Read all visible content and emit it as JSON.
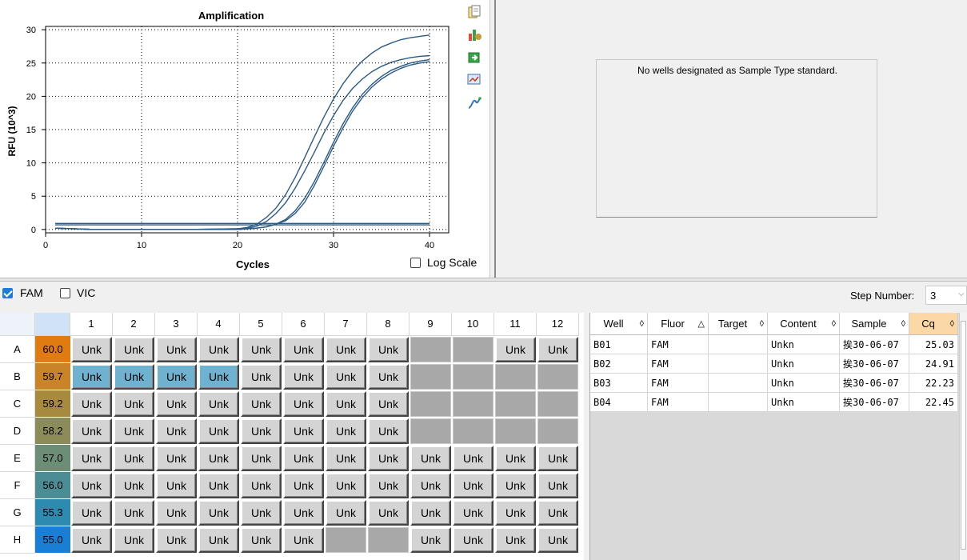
{
  "chart": {
    "title": "Amplification",
    "xlabel": "Cycles",
    "ylabel": "RFU (10^3)",
    "log_scale_label": "Log Scale",
    "log_scale_checked": false
  },
  "chart_data": {
    "type": "line",
    "title": "Amplification",
    "xlabel": "Cycles",
    "ylabel": "RFU (10^3)",
    "xlim": [
      0,
      42
    ],
    "ylim": [
      -0.5,
      30.5
    ],
    "xticks": [
      0,
      10,
      20,
      30,
      40
    ],
    "yticks": [
      0,
      5,
      10,
      15,
      20,
      25,
      30
    ],
    "grid": true,
    "series": [
      {
        "x": [
          1,
          5,
          10,
          15,
          20,
          21,
          22,
          23,
          24,
          25,
          26,
          27,
          28,
          29,
          30,
          31,
          32,
          33,
          34,
          35,
          36,
          37,
          38,
          39,
          40
        ],
        "y": [
          0.2,
          0.0,
          0.0,
          0.0,
          0.1,
          0.3,
          0.8,
          1.8,
          3.2,
          5.2,
          7.8,
          10.8,
          13.9,
          16.9,
          19.6,
          21.9,
          23.8,
          25.3,
          26.5,
          27.4,
          28.0,
          28.5,
          28.8,
          29.0,
          29.2
        ]
      },
      {
        "x": [
          1,
          5,
          10,
          15,
          20,
          21,
          22,
          23,
          24,
          25,
          26,
          27,
          28,
          29,
          30,
          31,
          32,
          33,
          34,
          35,
          36,
          37,
          38,
          39,
          40
        ],
        "y": [
          0.2,
          0.0,
          0.0,
          0.0,
          0.1,
          0.2,
          0.5,
          1.2,
          2.4,
          4.0,
          6.2,
          8.8,
          11.6,
          14.5,
          17.1,
          19.4,
          21.2,
          22.6,
          23.7,
          24.5,
          25.1,
          25.5,
          25.8,
          26.0,
          26.1
        ]
      },
      {
        "x": [
          1,
          5,
          10,
          15,
          20,
          21,
          22,
          23,
          24,
          25,
          26,
          27,
          28,
          29,
          30,
          31,
          32,
          33,
          34,
          35,
          36,
          37,
          38,
          39,
          40
        ],
        "y": [
          0.2,
          0.0,
          0.0,
          0.0,
          0.0,
          0.1,
          0.2,
          0.4,
          0.8,
          1.5,
          2.8,
          4.7,
          7.2,
          10.1,
          13.1,
          15.9,
          18.3,
          20.3,
          21.8,
          23.0,
          23.9,
          24.5,
          25.0,
          25.3,
          25.5
        ]
      },
      {
        "x": [
          1,
          5,
          10,
          15,
          20,
          21,
          22,
          23,
          24,
          25,
          26,
          27,
          28,
          29,
          30,
          31,
          32,
          33,
          34,
          35,
          36,
          37,
          38,
          39,
          40
        ],
        "y": [
          0.2,
          0.0,
          0.0,
          0.0,
          0.0,
          0.1,
          0.2,
          0.4,
          0.8,
          1.3,
          2.4,
          4.1,
          6.6,
          9.5,
          12.5,
          15.3,
          17.8,
          19.8,
          21.4,
          22.6,
          23.5,
          24.2,
          24.7,
          25.0,
          25.2
        ]
      },
      {
        "x": [
          1,
          40
        ],
        "y": [
          0.9,
          0.9
        ]
      },
      {
        "x": [
          1,
          40
        ],
        "y": [
          0.7,
          0.7
        ]
      }
    ]
  },
  "standard_panel": {
    "message": "No wells designated as Sample Type standard."
  },
  "toolbar": {
    "fam_label": "FAM",
    "fam_checked": true,
    "vic_label": "VIC",
    "vic_checked": false,
    "step_label": "Step Number:",
    "step_value": "3"
  },
  "plate": {
    "columns": [
      "1",
      "2",
      "3",
      "4",
      "5",
      "6",
      "7",
      "8",
      "9",
      "10",
      "11",
      "12"
    ],
    "rows": [
      {
        "label": "A",
        "temp": "60.0",
        "color": "#e07b12",
        "wells": [
          "Unk",
          "Unk",
          "Unk",
          "Unk",
          "Unk",
          "Unk",
          "Unk",
          "Unk",
          "",
          "",
          "Unk",
          "Unk"
        ],
        "selected": []
      },
      {
        "label": "B",
        "temp": "59.7",
        "color": "#c98427",
        "wells": [
          "Unk",
          "Unk",
          "Unk",
          "Unk",
          "Unk",
          "Unk",
          "Unk",
          "Unk",
          "",
          "",
          "",
          ""
        ],
        "selected": [
          0,
          1,
          2,
          3
        ]
      },
      {
        "label": "C",
        "temp": "59.2",
        "color": "#a88a3e",
        "wells": [
          "Unk",
          "Unk",
          "Unk",
          "Unk",
          "Unk",
          "Unk",
          "Unk",
          "Unk",
          "",
          "",
          "",
          ""
        ],
        "selected": []
      },
      {
        "label": "D",
        "temp": "58.2",
        "color": "#8c8c5a",
        "wells": [
          "Unk",
          "Unk",
          "Unk",
          "Unk",
          "Unk",
          "Unk",
          "Unk",
          "Unk",
          "",
          "",
          "",
          ""
        ],
        "selected": []
      },
      {
        "label": "E",
        "temp": "57.0",
        "color": "#6d8e76",
        "wells": [
          "Unk",
          "Unk",
          "Unk",
          "Unk",
          "Unk",
          "Unk",
          "Unk",
          "Unk",
          "Unk",
          "Unk",
          "Unk",
          "Unk"
        ],
        "selected": []
      },
      {
        "label": "F",
        "temp": "56.0",
        "color": "#4c8d95",
        "wells": [
          "Unk",
          "Unk",
          "Unk",
          "Unk",
          "Unk",
          "Unk",
          "Unk",
          "Unk",
          "Unk",
          "Unk",
          "Unk",
          "Unk"
        ],
        "selected": []
      },
      {
        "label": "G",
        "temp": "55.3",
        "color": "#2f8aaf",
        "wells": [
          "Unk",
          "Unk",
          "Unk",
          "Unk",
          "Unk",
          "Unk",
          "Unk",
          "Unk",
          "Unk",
          "Unk",
          "Unk",
          "Unk"
        ],
        "selected": []
      },
      {
        "label": "H",
        "temp": "55.0",
        "color": "#1a7fd4",
        "wells": [
          "Unk",
          "Unk",
          "Unk",
          "Unk",
          "Unk",
          "Unk",
          "",
          "",
          "Unk",
          "Unk",
          "Unk",
          "Unk"
        ],
        "selected": []
      }
    ]
  },
  "results": {
    "headers": [
      {
        "label": "Well",
        "sort": "◊"
      },
      {
        "label": "Fluor",
        "sort": "△"
      },
      {
        "label": "Target",
        "sort": "◊"
      },
      {
        "label": "Content",
        "sort": "◊"
      },
      {
        "label": "Sample",
        "sort": "◊"
      },
      {
        "label": "Cq",
        "sort": "◊"
      }
    ],
    "rows": [
      [
        "B01",
        "FAM",
        "",
        "Unkn",
        "挨30-06-07",
        "25.03"
      ],
      [
        "B02",
        "FAM",
        "",
        "Unkn",
        "挨30-06-07",
        "24.91"
      ],
      [
        "B03",
        "FAM",
        "",
        "Unkn",
        "挨30-06-07",
        "22.23"
      ],
      [
        "B04",
        "FAM",
        "",
        "Unkn",
        "挨30-06-07",
        "22.45"
      ]
    ]
  },
  "icons": [
    "copy-icon",
    "chart-settings-icon",
    "export-icon",
    "zoom-icon",
    "trace-icon"
  ]
}
